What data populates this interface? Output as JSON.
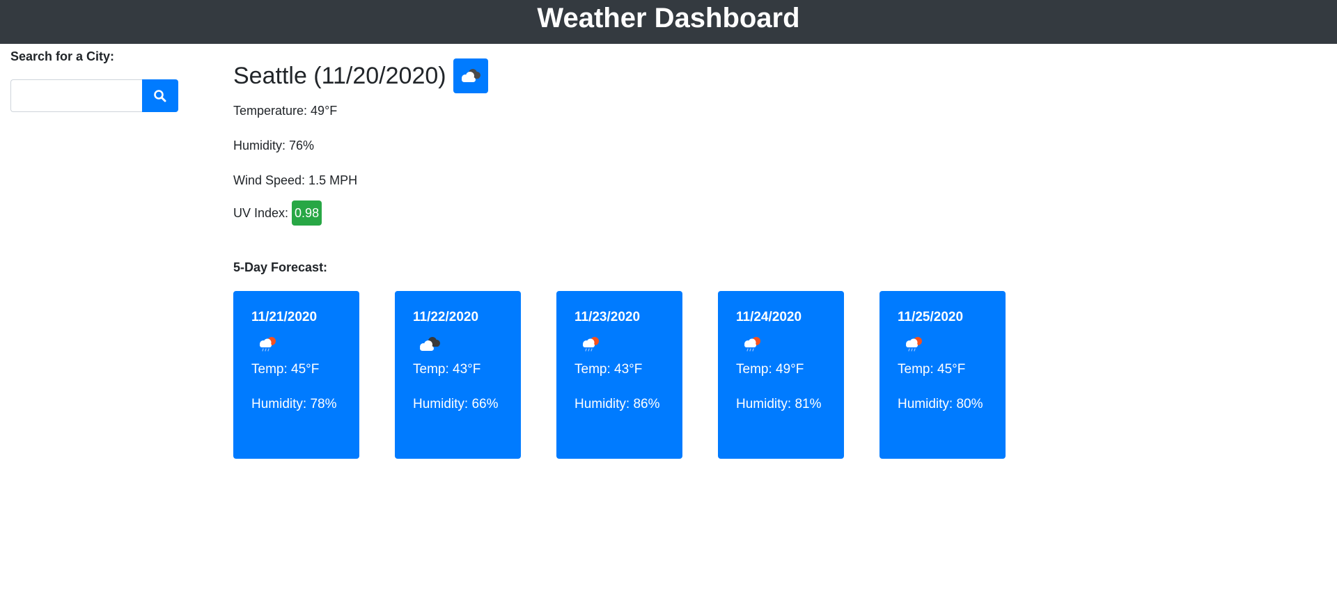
{
  "header": {
    "title": "Weather Dashboard"
  },
  "search": {
    "label": "Search for a City:",
    "value": "",
    "placeholder": ""
  },
  "current": {
    "title": "Seattle (11/20/2020)",
    "icon": "dark-cloud-icon",
    "temperature": "Temperature: 49°F",
    "humidity": "Humidity: 76%",
    "wind": "Wind Speed: 1.5 MPH",
    "uv_label": "UV Index:",
    "uv_value": "0.98",
    "uv_color": "#28a745"
  },
  "forecast": {
    "heading": "5-Day Forecast:",
    "days": [
      {
        "date": "11/21/2020",
        "icon": "rain-sun-icon",
        "temp": "Temp: 45°F",
        "humidity": "Humidity: 78%"
      },
      {
        "date": "11/22/2020",
        "icon": "dark-cloud-icon",
        "temp": "Temp: 43°F",
        "humidity": "Humidity: 66%"
      },
      {
        "date": "11/23/2020",
        "icon": "rain-sun-icon",
        "temp": "Temp: 43°F",
        "humidity": "Humidity: 86%"
      },
      {
        "date": "11/24/2020",
        "icon": "rain-sun-icon",
        "temp": "Temp: 49°F",
        "humidity": "Humidity: 81%"
      },
      {
        "date": "11/25/2020",
        "icon": "rain-sun-icon",
        "temp": "Temp: 45°F",
        "humidity": "Humidity: 80%"
      }
    ]
  },
  "colors": {
    "header_bg": "#343a40",
    "primary": "#007bff",
    "success": "#28a745"
  }
}
